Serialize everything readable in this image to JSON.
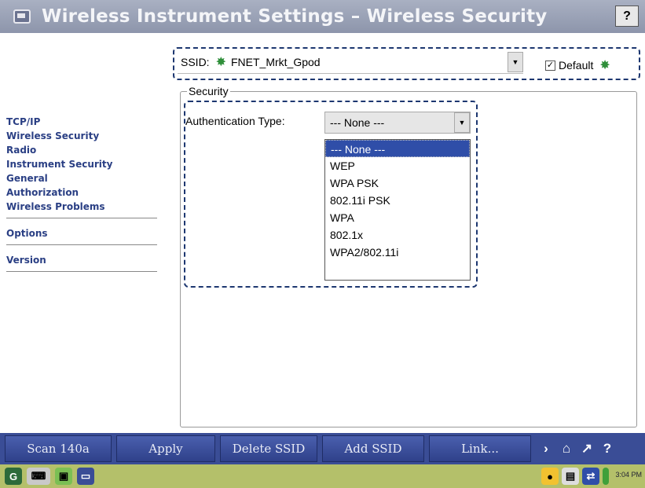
{
  "window": {
    "title": "Wireless Instrument Settings – Wireless Security",
    "help_glyph": "?"
  },
  "ssid": {
    "label": "SSID:",
    "value": "FNET_Mrkt_Gpod",
    "default_label": "Default",
    "default_checked": true
  },
  "nav": {
    "group1": [
      "TCP/IP",
      "Wireless Security",
      "Radio",
      "Instrument Security",
      "General",
      "Authorization",
      "Wireless Problems"
    ],
    "options": "Options",
    "version": "Version"
  },
  "security": {
    "group_label": "Security",
    "auth_label": "Authentication Type:",
    "auth_selected": "--- None ---",
    "options": [
      "--- None ---",
      "WEP",
      "WPA PSK",
      "802.11i PSK",
      "WPA",
      "802.1x",
      "WPA2/802.11i"
    ]
  },
  "toolbar": {
    "scan": "Scan 140a",
    "apply": "Apply",
    "delete": "Delete SSID",
    "add": "Add SSID",
    "link": "Link..."
  },
  "taskbar": {
    "clock": "3:04 PM"
  },
  "colors": {
    "toolbar": "#3a4d96",
    "nav_text": "#2a3f84",
    "selection": "#2f4ea8"
  }
}
